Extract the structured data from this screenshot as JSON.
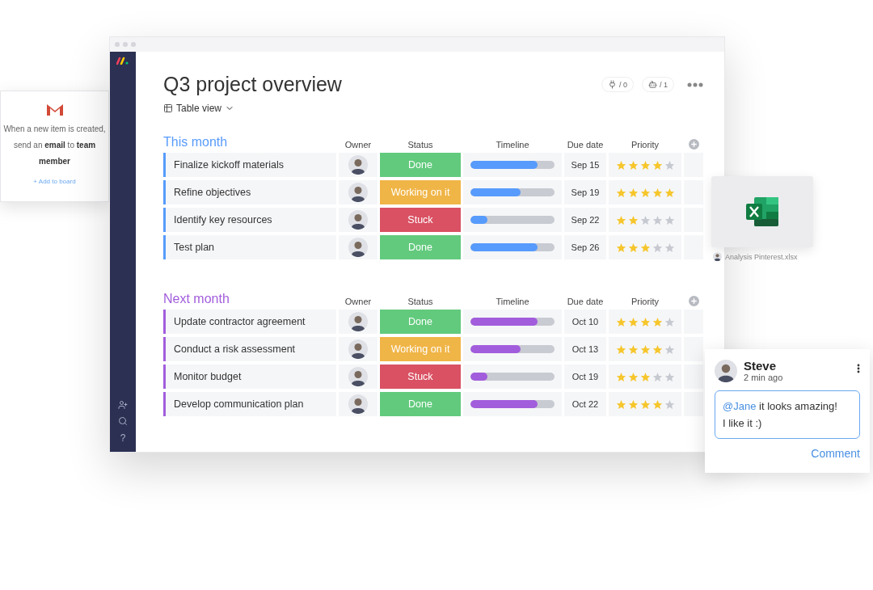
{
  "automation_card": {
    "text": "When a new item is created, send an **email** to **team member**",
    "link": "+ Add to board"
  },
  "sidebar": {
    "help": "?"
  },
  "board": {
    "title": "Q3 project overview",
    "view": "Table view",
    "counters": [
      {
        "kind": "integrations",
        "label": "/ 0"
      },
      {
        "kind": "automations",
        "label": "/ 1"
      }
    ],
    "groups": [
      {
        "title": "This month",
        "color": "#579bfc",
        "columns": [
          "Owner",
          "Status",
          "Timeline",
          "Due date",
          "Priority"
        ],
        "rows": [
          {
            "name": "Finalize kickoff materials",
            "status": {
              "kind": "done",
              "label": "Done"
            },
            "timeline": {
              "level": 0.8
            },
            "due": "Sep 15",
            "stars": 4
          },
          {
            "name": "Refine objectives",
            "status": {
              "kind": "working",
              "label": "Working on it"
            },
            "timeline": {
              "level": 0.6
            },
            "due": "Sep 19",
            "stars": 5
          },
          {
            "name": "Identify key resources",
            "status": {
              "kind": "stuck",
              "label": "Stuck"
            },
            "timeline": {
              "level": 0.2
            },
            "due": "Sep 22",
            "stars": 2
          },
          {
            "name": "Test plan",
            "status": {
              "kind": "done",
              "label": "Done"
            },
            "timeline": {
              "level": 0.8
            },
            "due": "Sep 26",
            "stars": 3
          }
        ]
      },
      {
        "title": "Next month",
        "color": "#a25ddc",
        "columns": [
          "Owner",
          "Status",
          "Timeline",
          "Due date",
          "Priority"
        ],
        "rows": [
          {
            "name": "Update contractor agreement",
            "status": {
              "kind": "done",
              "label": "Done"
            },
            "timeline": {
              "level": 0.8
            },
            "due": "Oct 10",
            "stars": 4
          },
          {
            "name": "Conduct a risk assessment",
            "status": {
              "kind": "working",
              "label": "Working on it"
            },
            "timeline": {
              "level": 0.6
            },
            "due": "Oct 13",
            "stars": 4
          },
          {
            "name": "Monitor budget",
            "status": {
              "kind": "stuck",
              "label": "Stuck"
            },
            "timeline": {
              "level": 0.2
            },
            "due": "Oct 19",
            "stars": 3
          },
          {
            "name": "Develop communication plan",
            "status": {
              "kind": "done",
              "label": "Done"
            },
            "timeline": {
              "level": 0.8
            },
            "due": "Oct 22",
            "stars": 4
          }
        ]
      }
    ]
  },
  "file_card": {
    "name": "Analysis Pinterest.xlsx"
  },
  "comment": {
    "author": "Steve",
    "time": "2 min ago",
    "mention": "@Jane",
    "text": "it looks amazing!",
    "text_2": "I like it :)",
    "action": "Comment"
  }
}
